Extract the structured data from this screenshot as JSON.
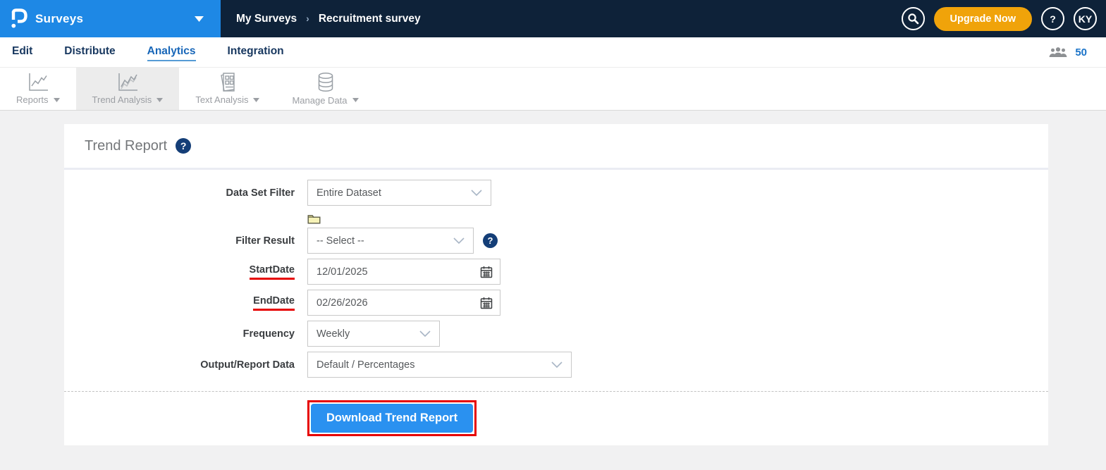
{
  "header": {
    "app_name": "Surveys",
    "breadcrumb": [
      "My Surveys",
      "Recruitment survey"
    ],
    "upgrade_label": "Upgrade Now",
    "avatar_initials": "KY"
  },
  "glyphs": {
    "help": "?",
    "breadcrumb_sep": "›"
  },
  "nav": {
    "tabs": [
      {
        "label": "Edit",
        "active": false
      },
      {
        "label": "Distribute",
        "active": false
      },
      {
        "label": "Analytics",
        "active": true
      },
      {
        "label": "Integration",
        "active": false
      }
    ],
    "respondent_count": "50"
  },
  "toolbar": {
    "items": [
      {
        "label": "Reports",
        "icon": "line-chart",
        "active": false
      },
      {
        "label": "Trend Analysis",
        "icon": "trend-line-chart",
        "active": true
      },
      {
        "label": "Text Analysis",
        "icon": "report-grid",
        "active": false
      },
      {
        "label": "Manage Data",
        "icon": "database",
        "active": false
      }
    ]
  },
  "main": {
    "title": "Trend Report",
    "form": {
      "dataset_label": "Data Set Filter",
      "dataset_value": "Entire Dataset",
      "filter_label": "Filter Result",
      "filter_value": "-- Select --",
      "start_label": "StartDate",
      "start_value": "12/01/2025",
      "end_label": "EndDate",
      "end_value": "02/26/2026",
      "frequency_label": "Frequency",
      "frequency_value": "Weekly",
      "output_label": "Output/Report Data",
      "output_value": "Default / Percentages"
    },
    "download_button": "Download Trend Report"
  },
  "icons": {
    "logo": "questionpro-p-logo",
    "search": "magnifier",
    "respondents": "people-group",
    "dataset_folder": "folder",
    "date_picker": "calendar",
    "dropdown": "chevron-down"
  },
  "colors": {
    "brand_blue": "#1e88e5",
    "header_navy": "#0e2239",
    "upgrade_orange": "#f0a30a",
    "active_tab_blue": "#1766b8",
    "link_blue": "#1a73c8",
    "help_badge_navy": "#143e77",
    "button_blue": "#2a91f0",
    "annotation_red": "#e60000"
  }
}
